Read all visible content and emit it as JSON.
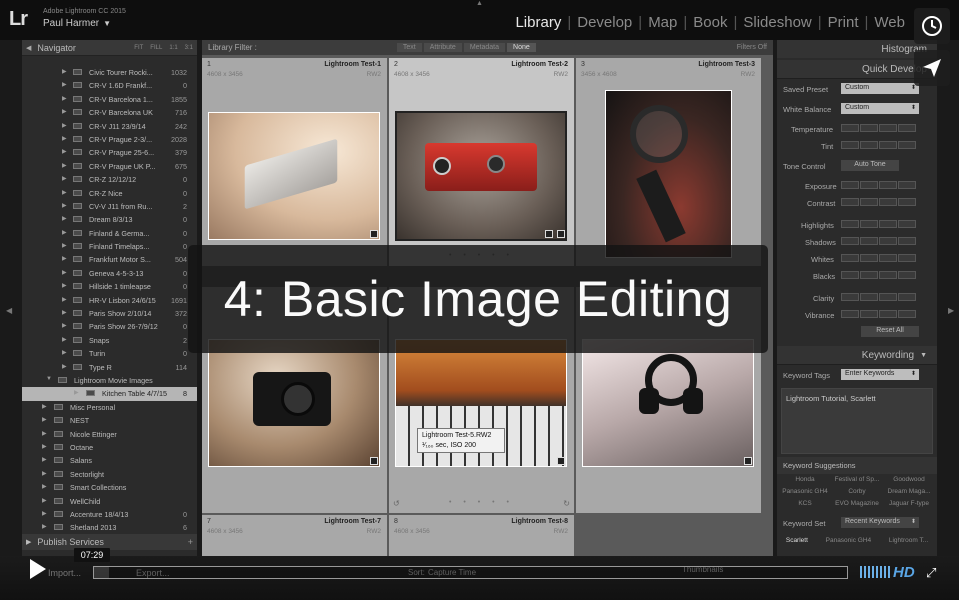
{
  "app": {
    "logo": "Lr",
    "title": "Adobe Lightroom CC 2015",
    "user": "Paul Harmer",
    "user_caret": "▼"
  },
  "modules": [
    {
      "label": "Library",
      "active": true
    },
    {
      "label": "Develop"
    },
    {
      "label": "Map"
    },
    {
      "label": "Book"
    },
    {
      "label": "Slideshow"
    },
    {
      "label": "Print"
    },
    {
      "label": "Web"
    }
  ],
  "navigator": {
    "title": "Navigator",
    "options": [
      "FIT",
      "FILL",
      "1:1",
      "3:1"
    ]
  },
  "folders": [
    {
      "label": "Civic Tourer Rocki...",
      "count": "1032"
    },
    {
      "label": "CR-V 1.6D Frankf...",
      "count": "0"
    },
    {
      "label": "CR-V Barcelona 1...",
      "count": "1855"
    },
    {
      "label": "CR-V Barcelona UK",
      "count": "716"
    },
    {
      "label": "CR-V J11 23/9/14",
      "count": "242"
    },
    {
      "label": "CR-V Prague 2-3/...",
      "count": "2028"
    },
    {
      "label": "CR-V Prague 25-6...",
      "count": "379"
    },
    {
      "label": "CR-V Prague UK P...",
      "count": "675"
    },
    {
      "label": "CR-Z 12/12/12",
      "count": "0"
    },
    {
      "label": "CR-Z Nice",
      "count": "0"
    },
    {
      "label": "CV-V J11 from Ru...",
      "count": "2"
    },
    {
      "label": "Dream 8/3/13",
      "count": "0"
    },
    {
      "label": "Finland & Germa...",
      "count": "0"
    },
    {
      "label": "Finland Timelaps...",
      "count": "0"
    },
    {
      "label": "Frankfurt Motor S...",
      "count": "504"
    },
    {
      "label": "Geneva 4-5-3-13",
      "count": "0"
    },
    {
      "label": "Hillside 1 timleapse",
      "count": "0"
    },
    {
      "label": "HR-V Lisbon 24/6/15",
      "count": "1691"
    },
    {
      "label": "Paris Show 2/10/14",
      "count": "372"
    },
    {
      "label": "Paris Show 26-7/9/12",
      "count": "0"
    },
    {
      "label": "Snaps",
      "count": "2"
    },
    {
      "label": "Turin",
      "count": "0"
    },
    {
      "label": "Type R",
      "count": "114"
    }
  ],
  "collections": [
    {
      "label": "Lightroom Movie Images",
      "count": ""
    },
    {
      "label": "Kitchen Table 4/7/15",
      "count": "8"
    },
    {
      "label": "Misc Personal",
      "count": ""
    },
    {
      "label": "NEST",
      "count": ""
    },
    {
      "label": "Nicole Ettinger",
      "count": ""
    },
    {
      "label": "Octane",
      "count": ""
    },
    {
      "label": "Salans",
      "count": ""
    },
    {
      "label": "Sectorlight",
      "count": ""
    },
    {
      "label": "Smart Collections",
      "count": ""
    },
    {
      "label": "WellChild",
      "count": ""
    },
    {
      "label": "Accenture 18/4/13",
      "count": "0"
    },
    {
      "label": "Shetland 2013",
      "count": "6"
    }
  ],
  "publish": {
    "title": "Publish Services",
    "plus": "+"
  },
  "filter": {
    "label": "Library Filter :",
    "tabs": [
      "Text",
      "Attribute",
      "Metadata",
      "None"
    ],
    "off": "Filters Off"
  },
  "cells": [
    {
      "num": "1",
      "name": "Lightroom Test-1",
      "dim": "4608 x 3456",
      "ext": "RW2"
    },
    {
      "num": "2",
      "name": "Lightroom Test-2",
      "dim": "4608 x 3456",
      "ext": "RW2"
    },
    {
      "num": "3",
      "name": "Lightroom Test-3",
      "dim": "3456 x 4608",
      "ext": "RW2"
    },
    {
      "num": "7",
      "name": "Lightroom Test-7",
      "dim": "4608 x 3456",
      "ext": "RW2"
    },
    {
      "num": "8",
      "name": "Lightroom Test-8",
      "dim": "4608 x 3456",
      "ext": "RW2"
    }
  ],
  "cells_row2": [
    "",
    "",
    ""
  ],
  "tooltip": {
    "line1": "Lightroom Test-5.RW2",
    "line2": "¹⁄₁₆₀ sec, ISO 200"
  },
  "histogram": {
    "title": "Histogram"
  },
  "quick": {
    "title": "Quick Develop",
    "saved_preset_label": "Saved Preset",
    "saved_preset_value": "Custom",
    "wb_label": "White Balance",
    "wb_value": "Custom",
    "temperature": "Temperature",
    "tint": "Tint",
    "tone_label": "Tone Control",
    "auto_tone": "Auto Tone",
    "exposure": "Exposure",
    "contrast": "Contrast",
    "highlights": "Highlights",
    "shadows": "Shadows",
    "whites": "Whites",
    "blacks": "Blacks",
    "clarity": "Clarity",
    "vibrance": "Vibrance",
    "reset": "Reset All"
  },
  "keywording": {
    "title": "Keywording",
    "tags_label": "Keyword Tags",
    "tags_value": "Enter Keywords",
    "text": "Lightroom Tutorial, Scarlett",
    "suggestions_label": "Keyword Suggestions",
    "suggestions": [
      "Honda",
      "Festival of Sp...",
      "Goodwood",
      "Panasonic GH4",
      "Corby",
      "Dream Maga...",
      "KCS",
      "EVO Magazine",
      "Jaguar F-type"
    ],
    "set_label": "Keyword Set",
    "set_value": "Recent Keywords",
    "set_items": [
      "Scarlett",
      "Panasonic GH4",
      "Lightroom T..."
    ]
  },
  "overlay": {
    "title": "4: Basic Image Editing"
  },
  "filmstrip": {
    "import": "Import...",
    "export": "Export...",
    "sort": "Sort:",
    "sort_value": "Capture Time",
    "thumbnails": "Thumbnails"
  },
  "video": {
    "time": "07:29",
    "progress": 0.02,
    "hd": "HD"
  }
}
